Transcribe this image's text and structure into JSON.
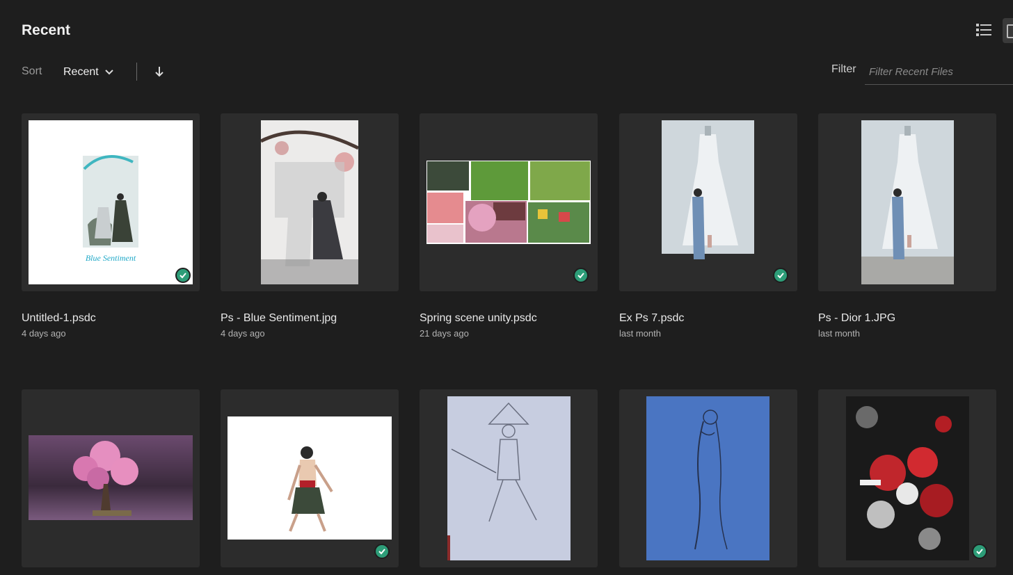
{
  "header": {
    "title": "Recent",
    "list_view_icon": "list-view-icon",
    "grid_view_icon": "grid-view-icon"
  },
  "toolbar": {
    "sort_label": "Sort",
    "sort_value": "Recent",
    "sort_direction_icon": "arrow-down-icon",
    "filter_label": "Filter",
    "filter_placeholder": "Filter Recent Files"
  },
  "files": [
    {
      "name": "Untitled-1.psdc",
      "date": "4 days ago",
      "synced": true,
      "thumbnail": "blue-sentiment-poster"
    },
    {
      "name": "Ps - Blue Sentiment.jpg",
      "date": "4 days ago",
      "synced": false,
      "thumbnail": "ink-painting-figures"
    },
    {
      "name": "Spring scene unity.psdc",
      "date": "21 days ago",
      "synced": true,
      "thumbnail": "spring-collage"
    },
    {
      "name": "Ex Ps 7.psdc",
      "date": "last month",
      "synced": true,
      "thumbnail": "dress-mannequin"
    },
    {
      "name": "Ps - Dior 1.JPG",
      "date": "last month",
      "synced": false,
      "thumbnail": "dress-mannequin"
    },
    {
      "name": "",
      "date": "",
      "synced": false,
      "thumbnail": "pink-bonsai"
    },
    {
      "name": "",
      "date": "",
      "synced": true,
      "thumbnail": "warrior-character"
    },
    {
      "name": "",
      "date": "",
      "synced": false,
      "thumbnail": "pencil-sketch-swordswoman"
    },
    {
      "name": "",
      "date": "",
      "synced": false,
      "thumbnail": "blue-sketch-figure"
    },
    {
      "name": "",
      "date": "",
      "synced": true,
      "thumbnail": "red-floral-geisha"
    }
  ],
  "colors": {
    "background": "#1e1e1e",
    "card": "#2c2c2c",
    "sync_badge": "#2d9d78"
  }
}
